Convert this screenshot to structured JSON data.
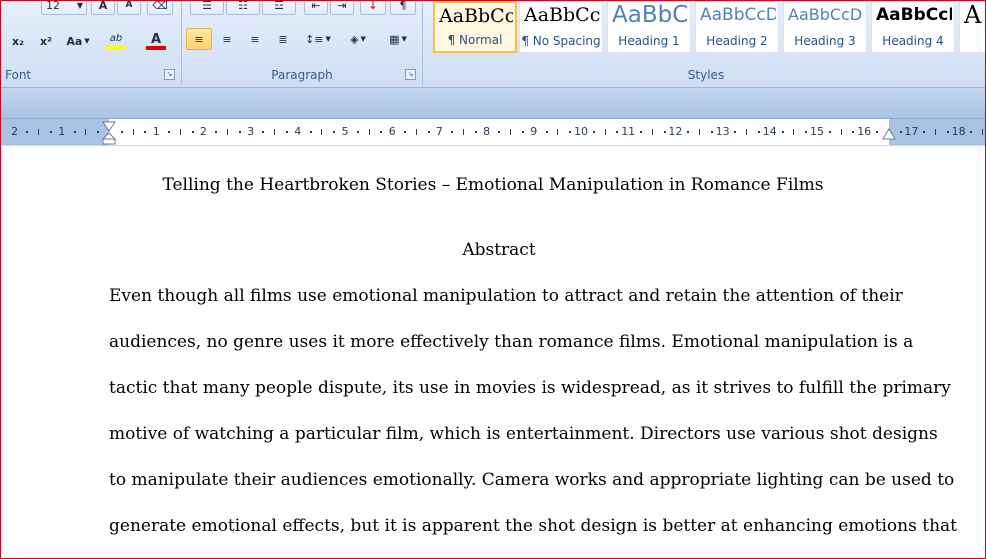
{
  "ribbon": {
    "font_group": {
      "label": "Font",
      "font_size": "12",
      "buttons": {
        "grow": "A",
        "shrink": "A",
        "clear": "⌫",
        "subscript": "x₂",
        "superscript": "x²",
        "change_case": "Aa",
        "highlight": "ab",
        "font_color": "A"
      }
    },
    "paragraph_group": {
      "label": "Paragraph"
    },
    "styles_group": {
      "label": "Styles",
      "styles": [
        {
          "sample": "AaBbCcI",
          "name": "¶ Normal"
        },
        {
          "sample": "AaBbCcI",
          "name": "¶ No Spacing"
        },
        {
          "sample": "AaBbCc",
          "name": "Heading 1"
        },
        {
          "sample": "AaBbCcD",
          "name": "Heading 2"
        },
        {
          "sample": "AaBbCcD",
          "name": "Heading 3"
        },
        {
          "sample": "AaBbCcI",
          "name": "Heading 4"
        },
        {
          "sample": "A",
          "name": ""
        }
      ]
    },
    "colors": {
      "highlight": "#ffff00",
      "font_color": "#e00000",
      "selected_style": "#f2c04d"
    }
  },
  "ruler": {
    "numbers": [
      "2",
      "1",
      "1",
      "2",
      "3",
      "4",
      "5",
      "6",
      "7",
      "8",
      "9",
      "10",
      "11",
      "12",
      "13",
      "14",
      "15",
      "16",
      "17",
      "18"
    ]
  },
  "document": {
    "title": "Telling the Heartbroken Stories – Emotional Manipulation in Romance Films",
    "heading": "Abstract",
    "lines": [
      "Even though all films use emotional manipulation to attract and retain the attention of their",
      "audiences, no genre uses it more effectively than romance films. Emotional manipulation is a",
      "tactic that many people dispute, its use in movies is widespread, as it strives to fulfill the primary",
      "motive of watching a particular film, which is entertainment. Directors use various shot designs",
      "to manipulate their audiences emotionally. Camera works and appropriate lighting can be used to",
      "generate emotional effects, but it is apparent the shot design is better at enhancing emotions that"
    ]
  }
}
